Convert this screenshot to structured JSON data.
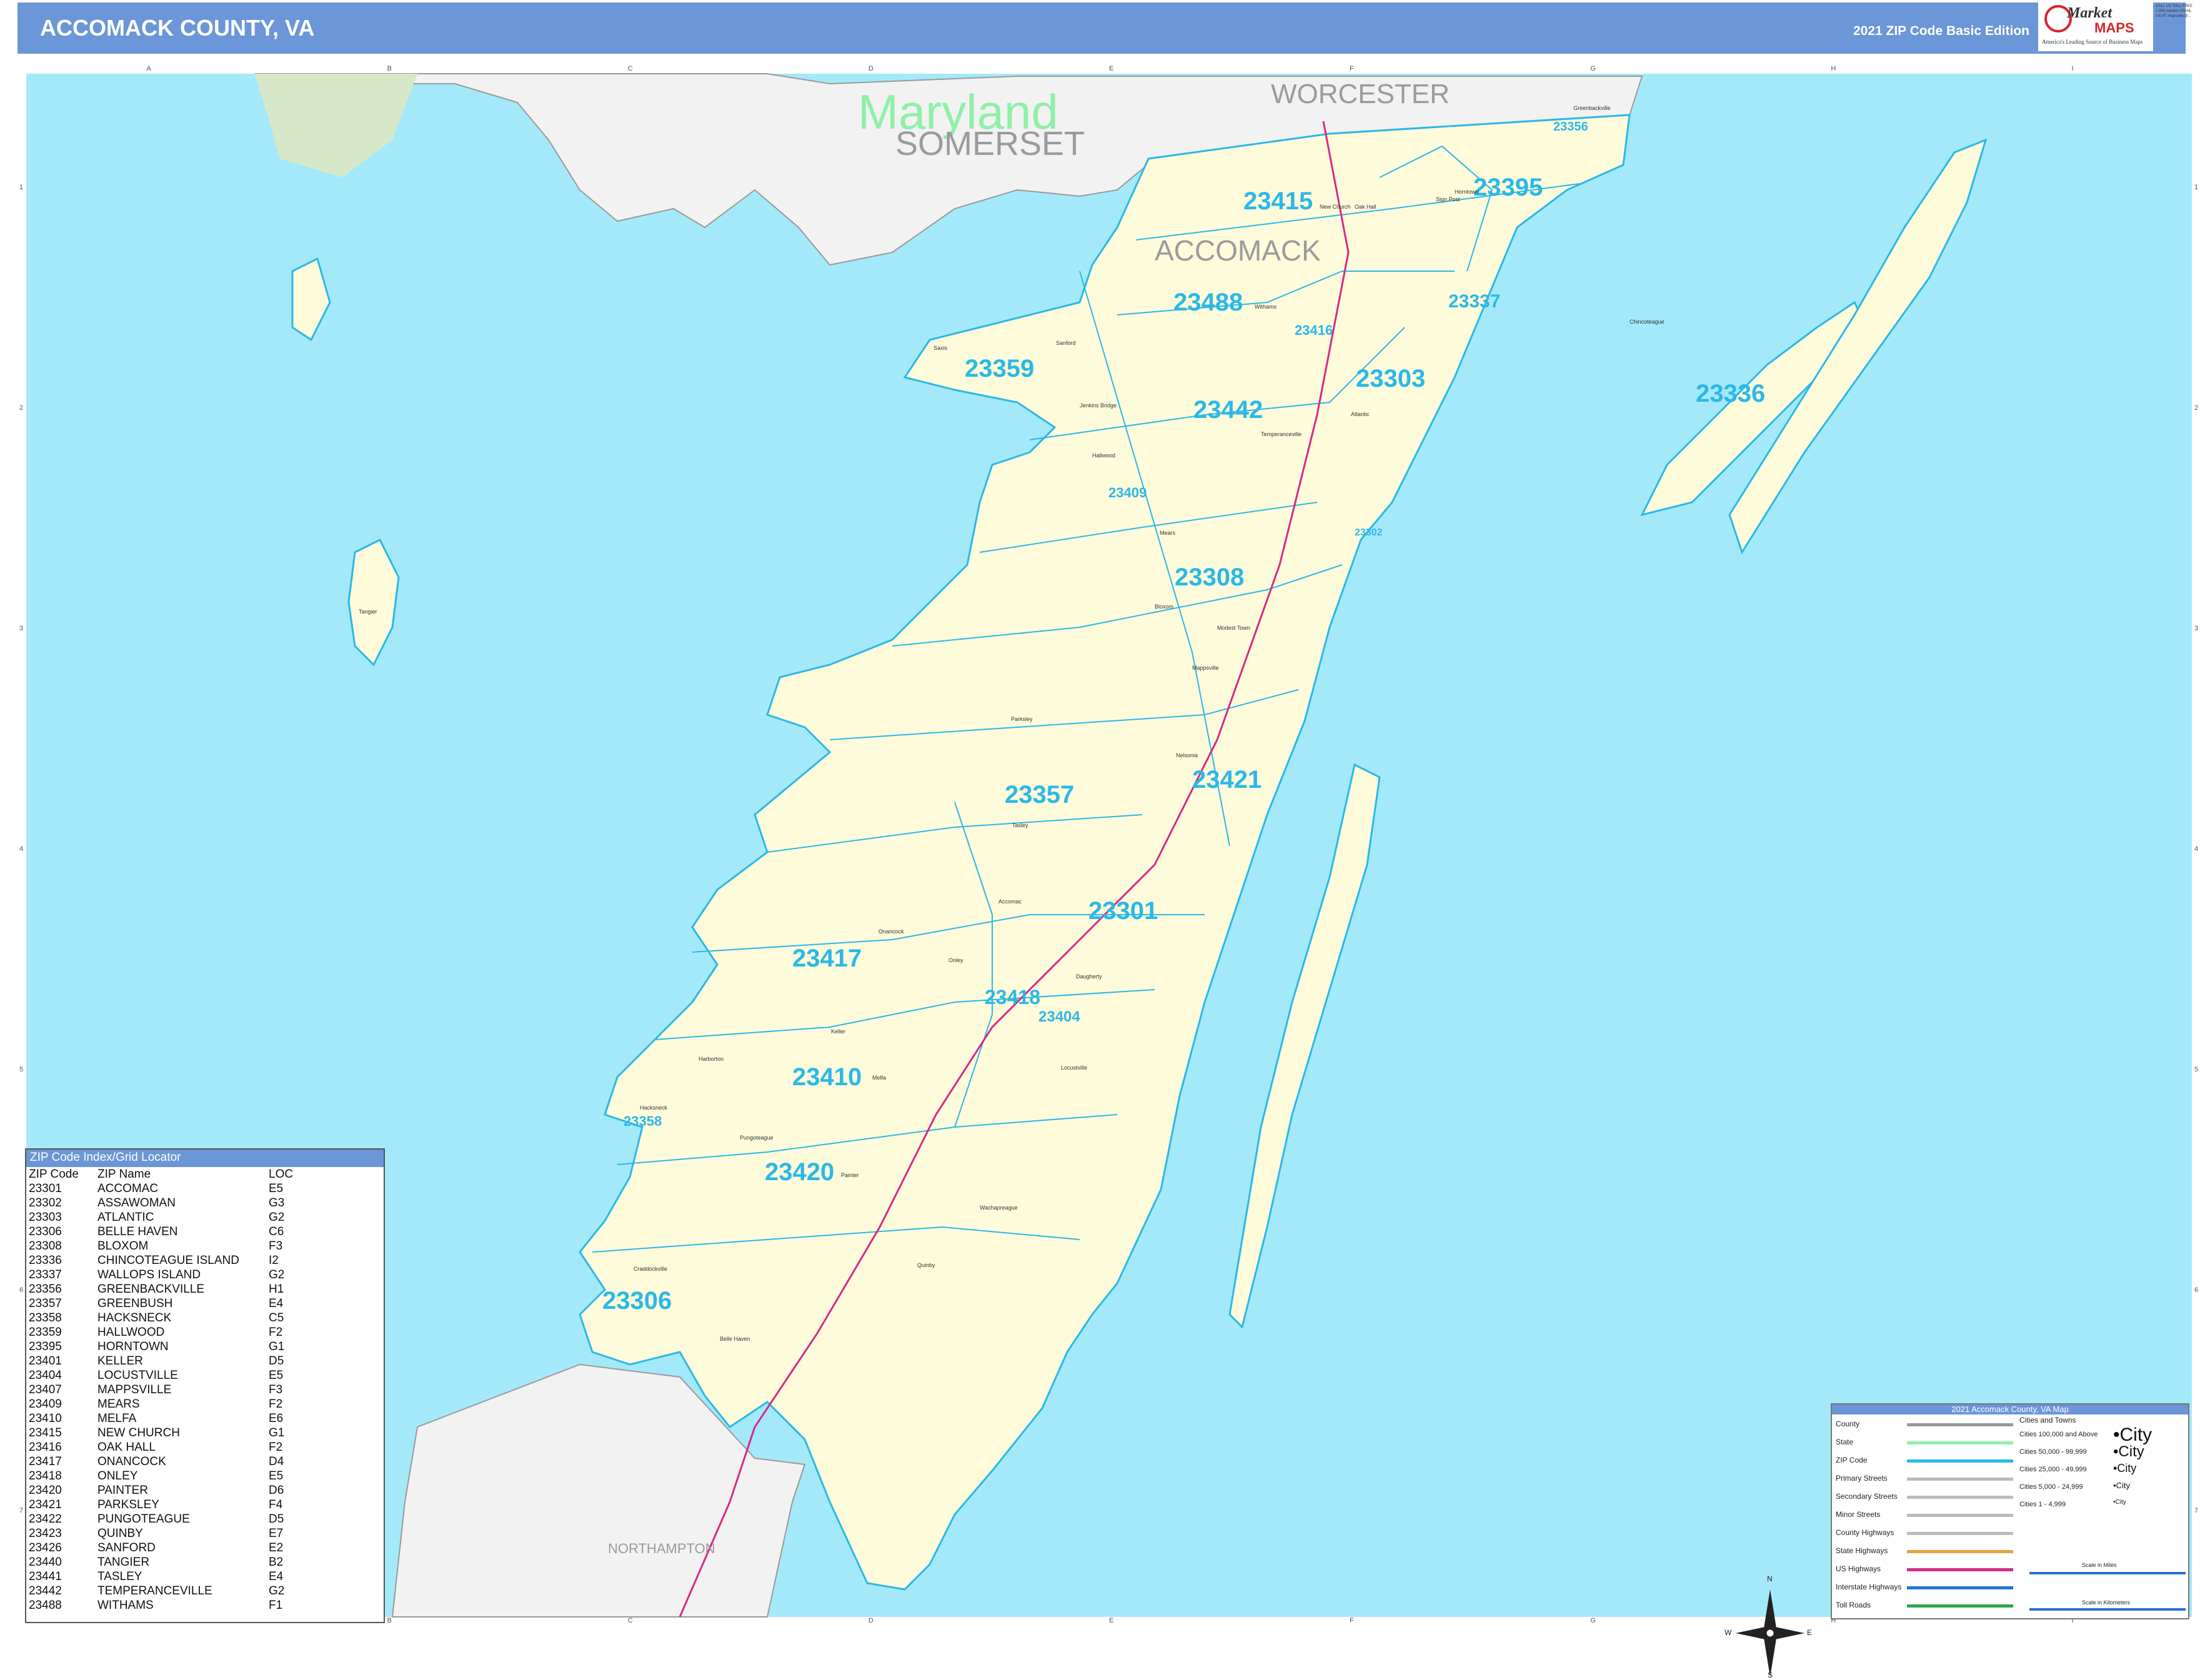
{
  "header": {
    "title": "ACCOMACK COUNTY, VA",
    "edition": "2021 ZIP Code Basic Edition",
    "logo_text_1": "Market",
    "logo_text_2": "MAPS",
    "logo_tagline": "America's Leading Source of Business Maps",
    "logo_taglines_small": "On Target, On Time",
    "contact": "CALL US TOLL FREE 1-800-number EMAIL US AT: mapsales@..."
  },
  "grid": {
    "columns": [
      "A",
      "B",
      "C",
      "D",
      "E",
      "F",
      "G",
      "H",
      "I"
    ],
    "rows": [
      "1",
      "2",
      "3",
      "4",
      "5",
      "6",
      "7"
    ]
  },
  "regions": {
    "state": "Maryland",
    "counties": [
      "SOMERSET",
      "WORCESTER",
      "ACCOMACK",
      "NORTHAMPTON"
    ]
  },
  "zip_labels": [
    {
      "zip": "23415"
    },
    {
      "zip": "23395"
    },
    {
      "zip": "23356"
    },
    {
      "zip": "23488"
    },
    {
      "zip": "23416"
    },
    {
      "zip": "23337"
    },
    {
      "zip": "23359"
    },
    {
      "zip": "23303"
    },
    {
      "zip": "23442"
    },
    {
      "zip": "23336"
    },
    {
      "zip": "23409"
    },
    {
      "zip": "23302"
    },
    {
      "zip": "23308"
    },
    {
      "zip": "23421"
    },
    {
      "zip": "23357"
    },
    {
      "zip": "23301"
    },
    {
      "zip": "23417"
    },
    {
      "zip": "23418"
    },
    {
      "zip": "23404"
    },
    {
      "zip": "23410"
    },
    {
      "zip": "23358"
    },
    {
      "zip": "23420"
    },
    {
      "zip": "23306"
    }
  ],
  "places": [
    "Greenbackville",
    "Sign Post",
    "New Church",
    "Horntown",
    "Oak Hall",
    "Hallwood",
    "Withams",
    "Sanford",
    "Jenkins Bridge",
    "Temperanceville",
    "Atlantic",
    "Chincoteague",
    "Saxis",
    "Mears",
    "Bloxom",
    "Parksley",
    "Onancock",
    "Accomac",
    "Tasley",
    "Onley",
    "Melfa",
    "Keller",
    "Painter",
    "Pungoteague",
    "Quinby",
    "Belle Haven",
    "Tangier",
    "Wachapreague",
    "Harborton",
    "Hacksneck",
    "Craddockville",
    "Locustville",
    "Daugherty",
    "Nelsonia",
    "Mappsville",
    "Modest Town"
  ],
  "zip_index": {
    "title": "ZIP Code Index/Grid Locator",
    "columns": [
      "ZIP Code",
      "ZIP Name",
      "LOC"
    ],
    "rows": [
      [
        "23301",
        "ACCOMAC",
        "E5"
      ],
      [
        "23302",
        "ASSAWOMAN",
        "G3"
      ],
      [
        "23303",
        "ATLANTIC",
        "G2"
      ],
      [
        "23306",
        "BELLE HAVEN",
        "C6"
      ],
      [
        "23308",
        "BLOXOM",
        "F3"
      ],
      [
        "23336",
        "CHINCOTEAGUE ISLAND",
        "I2"
      ],
      [
        "23337",
        "WALLOPS ISLAND",
        "G2"
      ],
      [
        "23356",
        "GREENBACKVILLE",
        "H1"
      ],
      [
        "23357",
        "GREENBUSH",
        "E4"
      ],
      [
        "23358",
        "HACKSNECK",
        "C5"
      ],
      [
        "23359",
        "HALLWOOD",
        "F2"
      ],
      [
        "23395",
        "HORNTOWN",
        "G1"
      ],
      [
        "23401",
        "KELLER",
        "D5"
      ],
      [
        "23404",
        "LOCUSTVILLE",
        "E5"
      ],
      [
        "23407",
        "MAPPSVILLE",
        "F3"
      ],
      [
        "23409",
        "MEARS",
        "F2"
      ],
      [
        "23410",
        "MELFA",
        "E6"
      ],
      [
        "23415",
        "NEW CHURCH",
        "G1"
      ],
      [
        "23416",
        "OAK HALL",
        "F2"
      ],
      [
        "23417",
        "ONANCOCK",
        "D4"
      ],
      [
        "23418",
        "ONLEY",
        "E5"
      ],
      [
        "23420",
        "PAINTER",
        "D6"
      ],
      [
        "23421",
        "PARKSLEY",
        "F4"
      ],
      [
        "23422",
        "PUNGOTEAGUE",
        "D5"
      ],
      [
        "23423",
        "QUINBY",
        "E7"
      ],
      [
        "23426",
        "SANFORD",
        "E2"
      ],
      [
        "23440",
        "TANGIER",
        "B2"
      ],
      [
        "23441",
        "TASLEY",
        "E4"
      ],
      [
        "23442",
        "TEMPERANCEVILLE",
        "G2"
      ],
      [
        "23488",
        "WITHAMS",
        "F1"
      ]
    ]
  },
  "legend": {
    "title": "2021 Accomack County, VA Map",
    "line_items": [
      "County",
      "State",
      "ZIP Code",
      "Primary Streets",
      "Secondary Streets",
      "Minor Streets",
      "County Highways",
      "State Highways",
      "US Highways",
      "Interstate Highways",
      "Toll Roads"
    ],
    "cities_header": "Cities and Towns",
    "city_items": [
      "Cities 100,000 and Above",
      "Cities 50,000 - 99,999",
      "Cities 25,000 - 49,999",
      "Cities 5,000 - 24,999",
      "Cities 1 - 4,999"
    ],
    "city_samples": [
      "•City",
      "•City",
      "•City",
      "•City",
      "•City"
    ],
    "scale_miles": "Scale in Miles",
    "scale_km": "Scale in Kilometers",
    "colors": {
      "county": "#9a9a9a",
      "state": "#8ff0a8",
      "zip": "#2bb8e8",
      "primary": "#bbbbbb",
      "state_hwy": "#e8a040",
      "us_hwy": "#d62a8a",
      "interstate": "#2a6fd6",
      "toll": "#2aa84a"
    }
  },
  "compass": {
    "n": "N",
    "s": "S",
    "e": "E",
    "w": "W"
  },
  "colors": {
    "water": "#a4e9f9",
    "land_accomack": "#fefbdb",
    "land_other": "#f2f2f2",
    "land_green": "#d7e8c8",
    "title_bar": "#6b96d7"
  }
}
